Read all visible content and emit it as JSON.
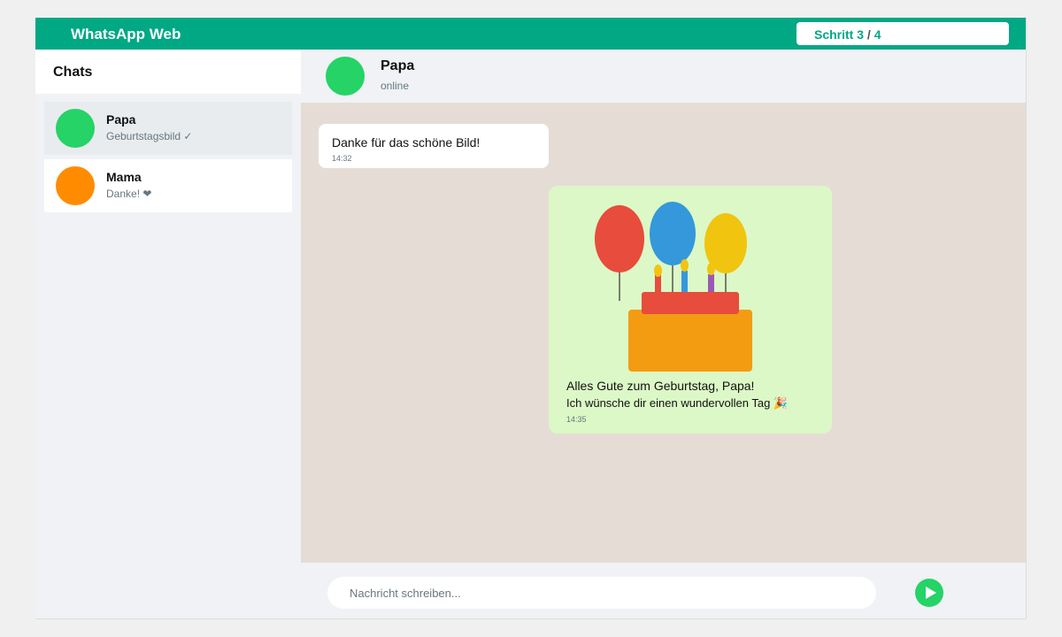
{
  "app": {
    "title": "WhatsApp Web"
  },
  "step": {
    "label": "Schritt 3",
    "separator": "/",
    "total": "4"
  },
  "sidebar": {
    "title": "Chats",
    "chats": [
      {
        "name": "Papa",
        "preview": "Geburtstagsbild ✓",
        "avatar_color": "#25d366",
        "active": true
      },
      {
        "name": "Mama",
        "preview": "Danke! ❤",
        "avatar_color": "#ff8c00",
        "active": false
      }
    ]
  },
  "conversation": {
    "name": "Papa",
    "status": "online",
    "avatar_color": "#25d366",
    "messages": [
      {
        "direction": "incoming",
        "text": "Danke für das schöne Bild!",
        "time": "14:32"
      },
      {
        "direction": "outgoing",
        "image": "birthday-cake-balloons-image",
        "caption_line1": "Alles Gute zum Geburtstag, Papa!",
        "caption_line2": "Ich wünsche dir einen wundervollen Tag 🎉",
        "time": "14:35"
      }
    ]
  },
  "composer": {
    "placeholder": "Nachricht schreiben...",
    "value": "",
    "send_icon": "send-play-icon"
  },
  "colors": {
    "brand": "#00a884",
    "chat_background": "#e5ddd5",
    "outgoing_bubble": "#dcf8c6",
    "send_button": "#25d366"
  }
}
